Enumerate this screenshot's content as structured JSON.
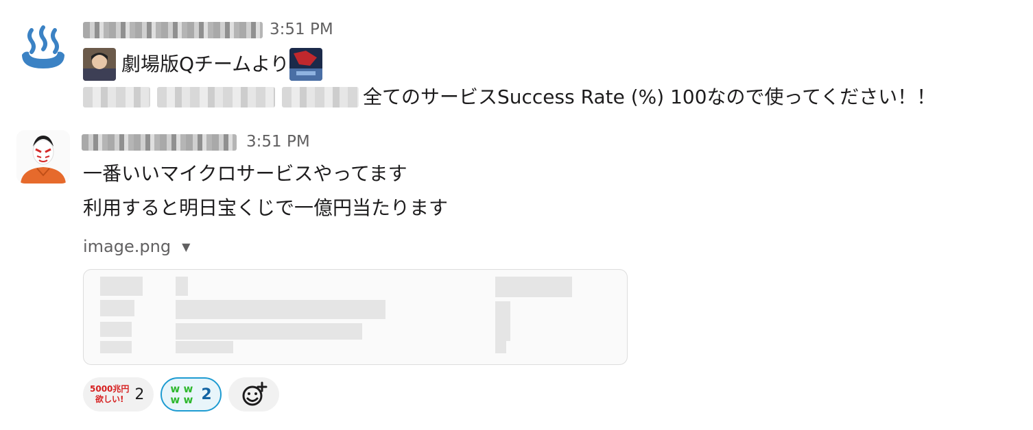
{
  "messages": [
    {
      "time": "3:51 PM",
      "line1": "劇場版Qチームより",
      "line2": "全てのサービスSuccess Rate (%) 100なので使ってください！！",
      "avatar_icon": "onsen-icon"
    },
    {
      "time": "3:51 PM",
      "line1": "一番いいマイクロサービスやってます",
      "line2": "利用すると明日宝くじで一億円当たります",
      "file_name": "image.png",
      "avatar_icon": "kabuki-avatar"
    }
  ],
  "reactions": [
    {
      "emoji_text_1": "5000兆円",
      "emoji_text_2": "欲しい!",
      "count": "2"
    },
    {
      "emoji_text_1": "w w",
      "emoji_text_2": "w w",
      "count": "2"
    }
  ],
  "colors": {
    "accent": "#1d9bd1",
    "onsen": "#3b82c4"
  }
}
